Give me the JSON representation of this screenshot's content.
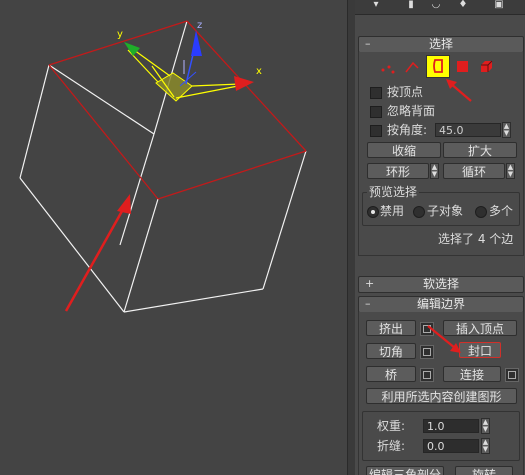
{
  "colors": {
    "accent_red": "#e01e1e",
    "highlight_yellow": "#ffff00",
    "viewport_bg": "#444444",
    "panel_bg": "#4a4a4a"
  },
  "viewport": {
    "axis_labels": {
      "x": "x",
      "y": "y",
      "z": "z"
    }
  },
  "toolbar": {
    "icons": [
      "pin-icon",
      "modifier-icon",
      "pivot-icon",
      "display-icon",
      "utilities-icon"
    ]
  },
  "selection": {
    "title": "选择",
    "subobject_icons": [
      "vertex-icon",
      "edge-icon",
      "border-icon",
      "polygon-icon",
      "element-icon"
    ],
    "active_icon": "border-icon",
    "by_vertex": "按顶点",
    "ignore_backfacing": "忽略背面",
    "by_angle": "按角度:",
    "angle_value": "45.0",
    "shrink": "收缩",
    "grow": "扩大",
    "ring": "环形",
    "loop": "循环",
    "preview_group": "预览选择",
    "preview_options": [
      "禁用",
      "子对象",
      "多个"
    ],
    "preview_selected": "禁用",
    "status": "选择了 4 个边"
  },
  "soft_selection": {
    "title": "软选择"
  },
  "edit_borders": {
    "title": "编辑边界",
    "extrude": "挤出",
    "insert_vertex": "插入顶点",
    "chamfer": "切角",
    "cap": "封口",
    "bridge": "桥",
    "connect": "连接",
    "create_shape": "利用所选内容创建图形",
    "weight_label": "权重:",
    "weight_value": "1.0",
    "crease_label": "折缝:",
    "crease_value": "0.0",
    "edit_tri": "编辑三角剖分",
    "rotate": "旋转"
  }
}
